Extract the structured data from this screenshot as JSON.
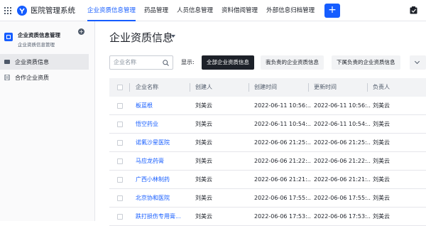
{
  "app": {
    "title": "医院管理系统"
  },
  "nav": [
    {
      "label": "企业资质信息管理",
      "active": true
    },
    {
      "label": "药品管理",
      "active": false
    },
    {
      "label": "人员信息管理",
      "active": false
    },
    {
      "label": "资料借阅管理",
      "active": false
    },
    {
      "label": "外部信息归档管理",
      "active": false
    }
  ],
  "toolbar": {
    "add_label": "+"
  },
  "sidebar": {
    "title": "企业资质信息管理",
    "subtitle": "企业资质信息管理",
    "add_label": "+",
    "items": [
      {
        "label": "企业资质信息",
        "active": true
      },
      {
        "label": "合作企业资质",
        "active": false
      }
    ]
  },
  "page": {
    "title": "企业资质信息"
  },
  "filter": {
    "search_placeholder": "企业名称",
    "show_label": "显示:",
    "segments": [
      "全部企业资质信息",
      "我负责的企业资质信息",
      "下属负责的企业资质信息"
    ]
  },
  "table": {
    "columns": [
      "企业名称",
      "创建人",
      "创建时间",
      "更新时间",
      "负责人"
    ],
    "rows": [
      [
        "板蓝根",
        "刘美云",
        "2022-06-11 10:56:...",
        "2022-06-11 10:56:...",
        "刘美云"
      ],
      [
        "悟空药业",
        "刘美云",
        "2022-06-11 10:54:...",
        "2022-06-11 10:54:...",
        "刘美云"
      ],
      [
        "诺氟沙星医院",
        "刘美云",
        "2022-06-06 21:25:...",
        "2022-06-06 21:25:...",
        "刘美云"
      ],
      [
        "马应龙药膏",
        "刘美云",
        "2022-06-06 21:22:...",
        "2022-06-06 21:22:...",
        "刘美云"
      ],
      [
        "广西小林制药",
        "刘美云",
        "2022-06-06 21:21:...",
        "2022-06-06 21:21:...",
        "刘美云"
      ],
      [
        "北京协和医院",
        "刘美云",
        "2022-06-06 17:55:...",
        "2022-06-06 17:55:...",
        "刘美云"
      ],
      [
        "跌打损伤专用膏...",
        "刘美云",
        "2022-06-06 17:53:...",
        "2022-06-06 17:53:...",
        "刘美云"
      ]
    ]
  },
  "colors": {
    "accent": "#165dff",
    "active_segment": "#1d2129"
  },
  "icons": [
    "grid-icon",
    "logo-icon",
    "checklist-icon",
    "search-icon",
    "chevron-down-icon",
    "folder-icon",
    "document-icon"
  ]
}
